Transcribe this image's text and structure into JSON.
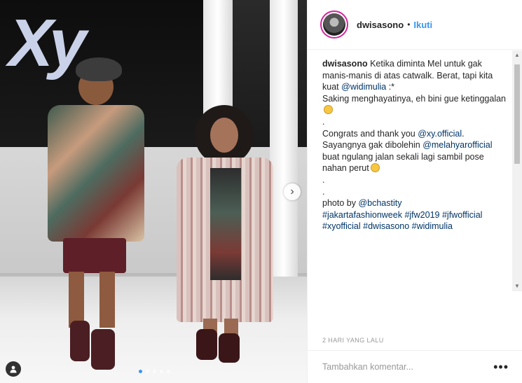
{
  "photo": {
    "brand_text": "Xy",
    "next_icon": "chevron-right-icon",
    "carousel": {
      "count": 5,
      "active": 0
    },
    "tag_icon": "person-tag-icon"
  },
  "header": {
    "username": "dwisasono",
    "separator": "•",
    "follow_label": "Ikuti"
  },
  "caption": {
    "username": "dwisasono",
    "line1": "Ketika diminta Mel untuk gak manis-manis di atas catwalk. Berat, tapi kita kuat",
    "mention1": "@widimulia",
    "line1_end": ":*",
    "line2": "Saking menghayatinya, eh bini gue ketinggalan",
    "dot1": ".",
    "line3_a": "Congrats and thank you",
    "mention2": "@xy.official",
    "line3_b": ".",
    "line4_a": "Sayangnya gak dibolehin",
    "mention3": "@melahyarofficial",
    "line4_b": "buat ngulang jalan sekali lagi sambil pose nahan perut",
    "dot2": ".",
    "dot3": ".",
    "photo_by": "photo by",
    "mention4": "@bchastity",
    "hashtags_line1": [
      "#jakartafashionweek",
      "#jfw2019",
      "#jfwofficial"
    ],
    "hashtags_line2": [
      "#xyofficial",
      "#dwisasono",
      "#widimulia"
    ]
  },
  "timestamp": "2 HARI YANG LALU",
  "comment": {
    "placeholder": "Tambahkan komentar...",
    "more_label": "•••"
  },
  "colors": {
    "link": "#003569",
    "follow": "#3897f0",
    "muted": "#999999"
  }
}
